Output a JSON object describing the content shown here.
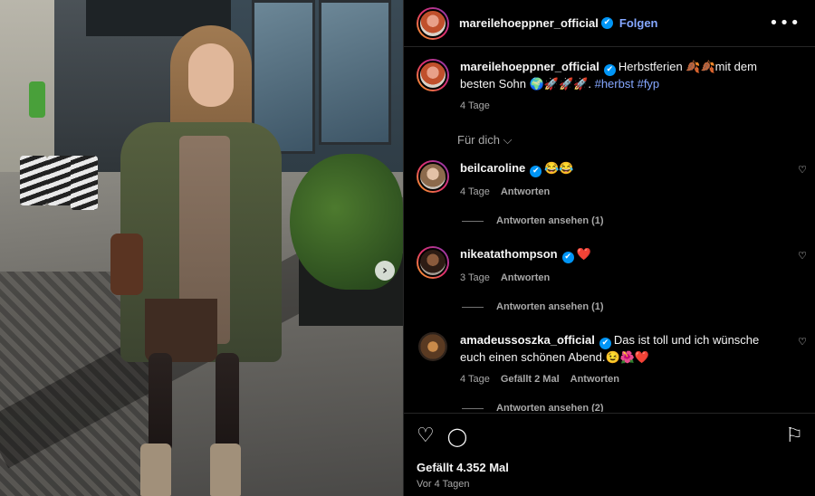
{
  "post": {
    "username": "mareilehoeppner_official",
    "follow_label": "Folgen",
    "more_icon": "•••",
    "caption_prefix": "Herbstferien 🍂🍂mit dem besten Sohn 🌍🚀🚀🚀. ",
    "hashtag1": "#herbst",
    "hashtag2": "#fyp",
    "caption_age": "4 Tage",
    "sort_label": "Für dich ⌵",
    "likes": "Gefällt 4.352 Mal",
    "posted": "Vor 4 Tagen"
  },
  "comments": [
    {
      "username": "beilcaroline",
      "text": "😂😂",
      "age": "4 Tage",
      "reply_label": "Antworten",
      "view_replies": "Antworten ansehen (1)"
    },
    {
      "username": "nikeatathompson",
      "text": "❤️",
      "age": "3 Tage",
      "reply_label": "Antworten",
      "view_replies": "Antworten ansehen (1)"
    },
    {
      "username": "amadeussoszka_official",
      "text": "Das ist toll und ich wünsche euch einen schönen Abend.😉🌺❤️",
      "age": "4 Tage",
      "likes": "Gefällt 2 Mal",
      "reply_label": "Antworten",
      "view_replies": "Antworten ansehen (2)"
    }
  ],
  "icons": {
    "verified": "✔",
    "heart_small": "♡",
    "carousel_next": "›",
    "like": "♡",
    "comment": "◯",
    "bookmark": "⚐"
  }
}
